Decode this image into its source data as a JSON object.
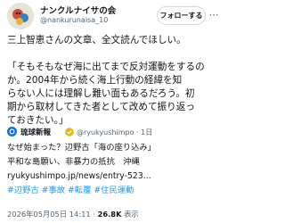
{
  "post": {
    "display_name": "ナンクルナイサの会",
    "handle": "@nankurunaisa_10",
    "follow_label": "フォローする",
    "more_label": "⋯",
    "line1": "三上智恵さんの文章、全文読んでほしい。",
    "quote_lines": [
      "「そもそもなぜ海に出てまで反対運動をするの",
      "か。2004年から続く海上行動の経緯を知",
      "らない人には理解し難い面もあるだろう。初",
      "期から取材してきた者として改めて振り返っ",
      "ておきたい。」"
    ]
  },
  "quote": {
    "name": "琉球新報",
    "handle": "@ryukyushimpo · 1日",
    "lines": [
      "なぜ始まった？辺野古「海の座り込み」",
      "平和な島願い、非暴力の抵抗　沖縄",
      "ryukyushimpo.jp/news/entry-523..."
    ],
    "hashtags": [
      "#辺野古",
      "#事故",
      "#転覆",
      "#住民運動"
    ]
  },
  "meta": {
    "time": "2026年05月05日 14:11",
    "sep": " · ",
    "views_count": "26.8K",
    "views_label": " 表示"
  },
  "colors": {
    "accent": "#1d9bf0",
    "muted": "#536471",
    "text": "#0f1419"
  }
}
